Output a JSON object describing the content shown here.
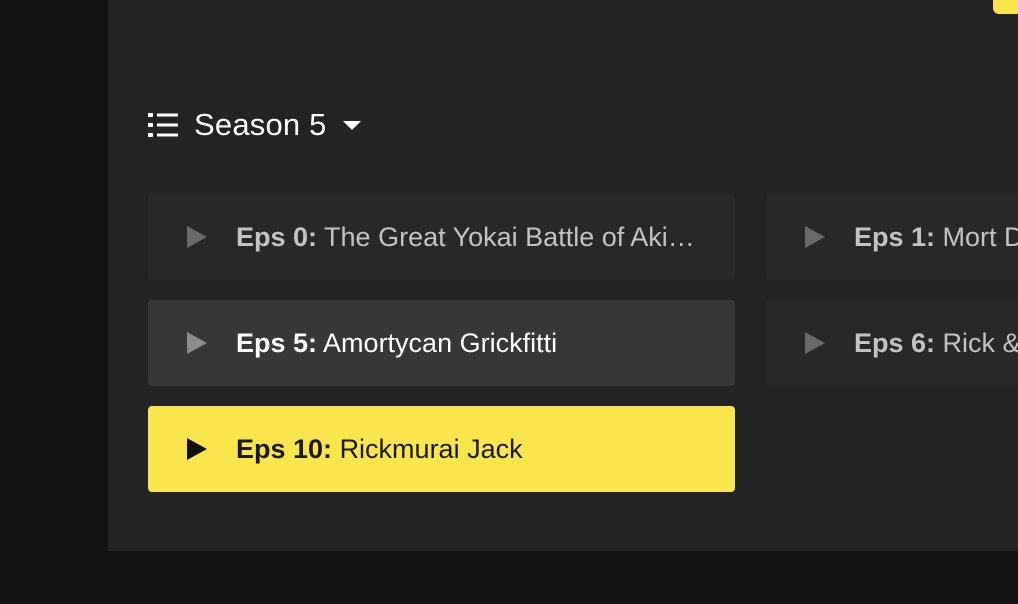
{
  "season_selector": {
    "label": "Season 5"
  },
  "episodes": [
    {
      "num": "Eps 0:",
      "title": "The Great Yokai Battle of Aki…",
      "state": "default"
    },
    {
      "num": "Eps 1:",
      "title": "Mort D",
      "state": "default"
    },
    {
      "num": "Eps 5:",
      "title": "Amortycan Grickfitti",
      "state": "hover"
    },
    {
      "num": "Eps 6:",
      "title": "Rick &",
      "state": "default"
    },
    {
      "num": "Eps 10:",
      "title": "Rickmurai Jack",
      "state": "active"
    }
  ],
  "colors": {
    "accent": "#fae54d",
    "page_background": "#131313",
    "panel_background": "#232323",
    "card_default": "#282828",
    "card_hover": "#373737"
  }
}
